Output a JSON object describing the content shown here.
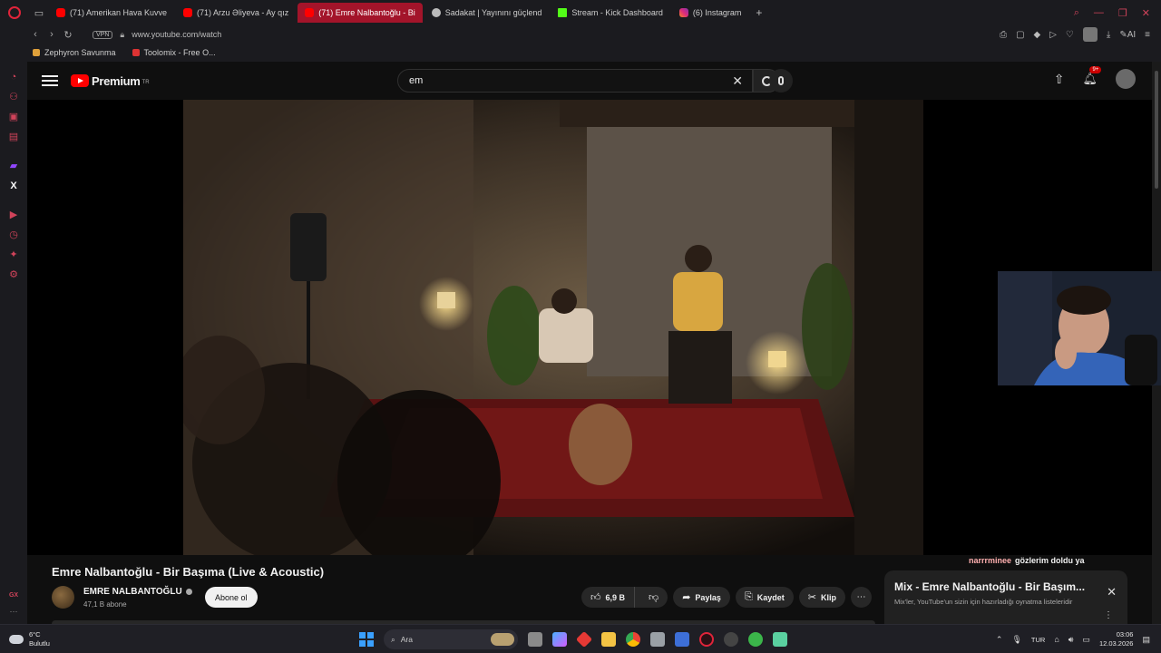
{
  "browser": {
    "tabs": [
      {
        "label": "(71) Amerikan Hava Kuvve",
        "favicon": "youtube",
        "active": false
      },
      {
        "label": "(71) Arzu Əliyeva - Ay qız",
        "favicon": "youtube",
        "active": false
      },
      {
        "label": "(71) Emre Nalbantoğlu - Bi",
        "favicon": "youtube",
        "active": true
      },
      {
        "label": "Sadakat | Yayınını güçlend",
        "favicon": "gear",
        "active": false
      },
      {
        "label": "Stream - Kick Dashboard",
        "favicon": "kick",
        "active": false
      },
      {
        "label": "(6) Instagram",
        "favicon": "instagram",
        "active": false
      }
    ],
    "new_tab": "+",
    "vpn_label": "VPN",
    "url": "www.youtube.com/watch",
    "ai_label": "AI",
    "bookmarks": [
      {
        "label": "Zephyron Savunma"
      },
      {
        "label": "Toolomix - Free O..."
      }
    ],
    "sidebar_bottom_label": "GX",
    "accent_color": "#d0435a"
  },
  "youtube": {
    "logo_text": "Premium",
    "region": "TR",
    "search_value": "em",
    "notification_count": "9+",
    "video": {
      "title": "Emre Nalbantoğlu - Bir Başıma (Live & Acoustic)",
      "channel": "EMRE NALBANTOĞLU",
      "subscribers": "47,1 B abone",
      "subscribe_label": "Abone ol",
      "likes": "6,9 B",
      "share_label": "Paylaş",
      "save_label": "Kaydet",
      "clip_label": "Klip"
    },
    "mix": {
      "title": "Mix - Emre Nalbantoğlu - Bir Başım...",
      "subtitle": "Mix'ler, YouTube'un sizin için hazırladığı oynatma listeleridir"
    }
  },
  "stream_overlay": {
    "chat_user": "narrrminee",
    "chat_message": "gözlerim doldu ya"
  },
  "taskbar": {
    "weather_temp": "6°C",
    "weather_desc": "Bulutlu",
    "search_placeholder": "Ara",
    "language": "TUR",
    "time": "03:06",
    "date": "12.03.2026"
  }
}
